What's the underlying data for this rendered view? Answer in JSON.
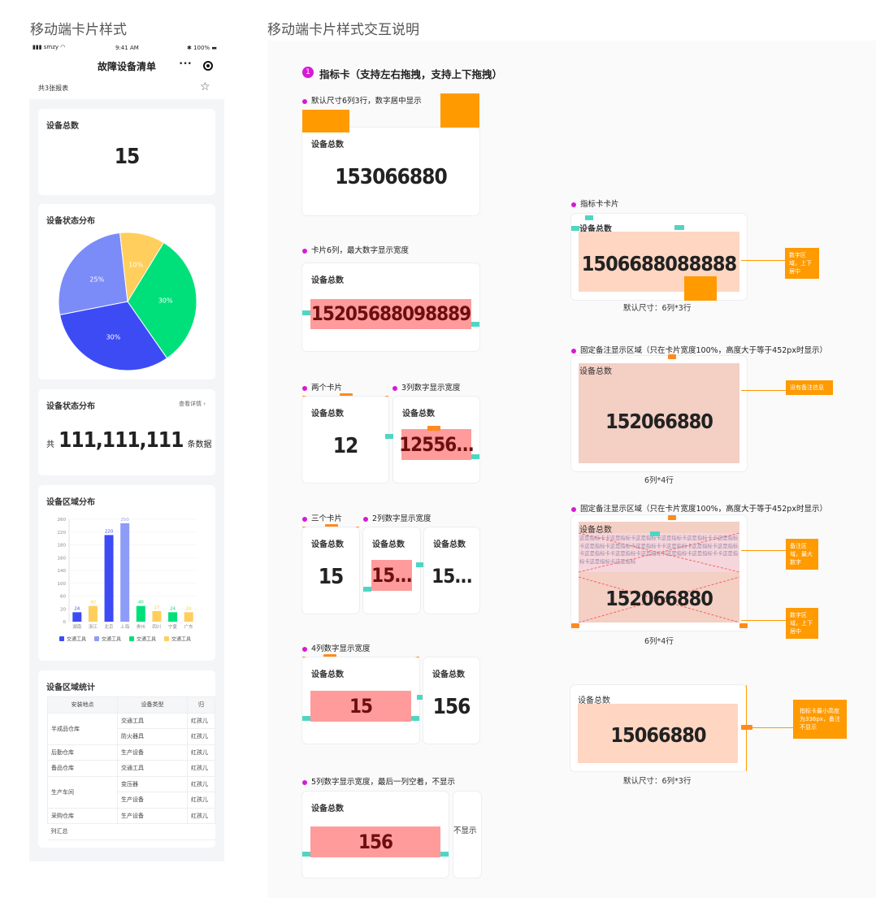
{
  "left_section_title": "移动端卡片样式",
  "right_section_title": "移动端卡片样式交互说明",
  "phone": {
    "status": {
      "carrier": "smzy",
      "time": "9:41 AM",
      "battery": "100%"
    },
    "title": "故障设备清单",
    "more": "•••",
    "report_count": "共3张报表",
    "card_total": {
      "title": "设备总数",
      "value": "15"
    },
    "card_pie": {
      "title": "设备状态分布"
    },
    "card_count": {
      "title": "设备状态分布",
      "link": "查看详情",
      "prefix": "共",
      "value": "111,111,111",
      "suffix": "条数据"
    },
    "card_bar": {
      "title": "设备区域分布"
    },
    "card_table": {
      "title": "设备区域统计",
      "headers": [
        "安装地点",
        "设备类型",
        "归"
      ],
      "rows": [
        [
          "半成品仓库",
          "交通工具",
          "红孩儿"
        ],
        [
          "",
          "防火器具",
          "红孩儿"
        ],
        [
          "后勤仓库",
          "生产设备",
          "红孩儿"
        ],
        [
          "备品仓库",
          "交通工具",
          "红孩儿"
        ],
        [
          "生产车间",
          "变压器",
          "红孩儿"
        ],
        [
          "",
          "生产设备",
          "红孩儿"
        ],
        [
          "采购仓库",
          "生产设备",
          "红孩儿"
        ]
      ],
      "footer": "列汇总"
    }
  },
  "chart_data": [
    {
      "type": "pie",
      "title": "设备状态分布",
      "slices": [
        {
          "label": "30%",
          "value": 30,
          "color": "#00e07a"
        },
        {
          "label": "30%",
          "value": 30,
          "color": "#3d4bf5"
        },
        {
          "label": "25%",
          "value": 25,
          "color": "#7b8cf8"
        },
        {
          "label": "10%",
          "value": 10,
          "color": "#ffce5c"
        }
      ]
    },
    {
      "type": "bar",
      "title": "设备区域分布",
      "categories": [
        "湖南",
        "浙江",
        "北京",
        "上海",
        "贵州",
        "四川",
        "宁夏",
        "广东"
      ],
      "values": [
        24,
        40,
        220,
        250,
        40,
        27,
        24,
        24
      ],
      "colors": [
        "#3d4bf5",
        "#ffce5c",
        "#3d4bf5",
        "#8d9bf9",
        "#00e07a",
        "#ffce5c",
        "#00e07a",
        "#ffce5c"
      ],
      "yticks": [
        "260",
        "220",
        "180",
        "160",
        "140",
        "100",
        "60",
        "20",
        "0"
      ],
      "ylim": [
        0,
        260
      ],
      "legend": [
        {
          "label": "交通工具",
          "color": "#3d4bf5"
        },
        {
          "label": "交通工具",
          "color": "#8d9bf9"
        },
        {
          "label": "交通工具",
          "color": "#00e07a"
        },
        {
          "label": "交通工具",
          "color": "#ffce5c"
        }
      ]
    }
  ],
  "spec": {
    "heading_num": "1",
    "heading": "指标卡（支持左右拖拽，支持上下拖拽）",
    "default_label": "默认尺寸6列3行，数字居中显示",
    "card_title": "设备总数",
    "default_value": "153066880",
    "six_col_label": "卡片6列，最大数字显示宽度",
    "six_col_value": "15205688098889",
    "two_cards_label": "两个卡片",
    "two_cards_value": "12",
    "three_col_label": "3列数字显示宽度",
    "three_col_value": "12556...",
    "three_cards_label": "三个卡片",
    "three_cards_a": "15",
    "two_col_label": "2列数字显示宽度",
    "two_col_value": "15...",
    "three_cards_c": "15...",
    "four_col_label": "4列数字显示宽度",
    "four_col_value": "15",
    "four_col_side": "156",
    "five_col_label": "5列数字显示宽度，最后一列空着，不显示",
    "five_col_value": "156",
    "no_show": "不显示",
    "indicator_label": "指标卡卡片",
    "indicator_value": "1506688088888",
    "indicator_caption": "默认尺寸：6列*3行",
    "callout_number": "数字区域，上下居中",
    "fixed_label_a": "固定备注显示区域（只在卡片宽度100%，高度大于等于452px时显示）",
    "fixed_value_a": "152066880",
    "callout_no_note": "没有备注信息",
    "caption_64a": "6列*4行",
    "fixed_label_b": "固定备注显示区域（只在卡片宽度100%，高度大于等于452px时显示）",
    "note_text": "这是指标卡卡这是指标卡这是指标卡这是指标卡这是指标卡卡这是指标卡这是指标卡这是指标卡这是指标卡卡这是指标卡这是指标卡这是指标卡这是指标卡卡这是指标卡这是指标卡这是指标卡这是指标卡卡这是指标卡这是指标卡这是指标",
    "fixed_value_b": "152066880",
    "callout_note": "备注区域，最大数字",
    "callout_number_b": "数字区域，上下居中",
    "caption_64b": "6列*4行",
    "min_value": "15066880",
    "callout_min": "指标卡最小高度为336px，备注不显示",
    "min_caption": "默认尺寸：6列*3行"
  }
}
